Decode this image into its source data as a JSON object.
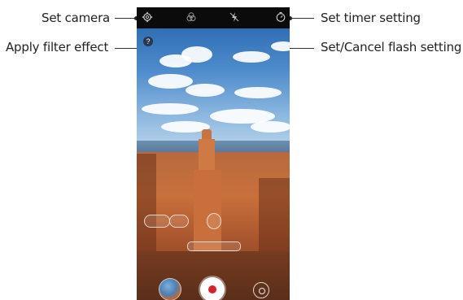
{
  "callouts": {
    "set_camera": "Set camera",
    "apply_filter": "Apply filter effect",
    "set_timer": "Set timer setting",
    "flash": "Set/Cancel flash setting"
  },
  "camera_ui": {
    "top_icons": [
      "gear-icon",
      "filter-icon",
      "flash-off-icon",
      "timer-icon"
    ],
    "help_glyph": "?",
    "bottom_controls": [
      "gallery-thumbnail",
      "record-button",
      "switch-camera-icon"
    ],
    "record_color": "#d8202a"
  }
}
